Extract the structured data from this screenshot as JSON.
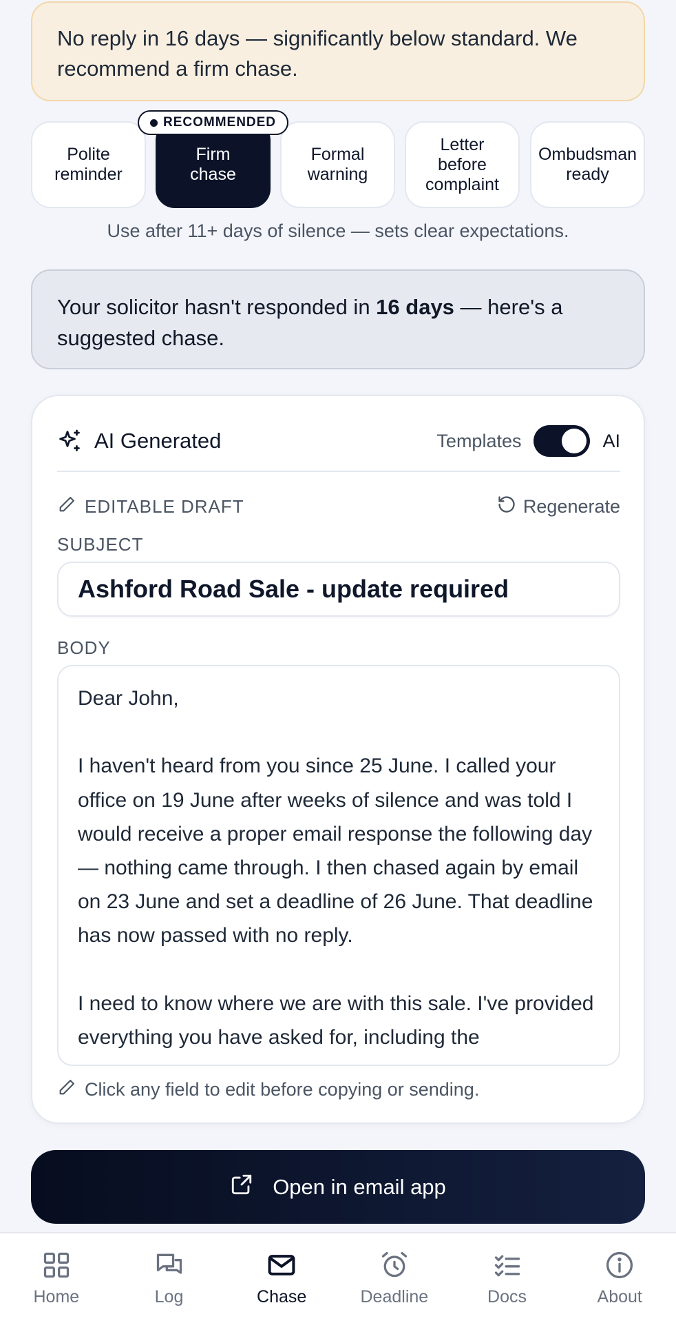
{
  "alert": {
    "text": "No reply in 16 days — significantly below standard. We recommend a firm chase."
  },
  "tones": {
    "badge": "RECOMMENDED",
    "options": [
      {
        "label": "Polite reminder"
      },
      {
        "label": "Firm chase"
      },
      {
        "label": "Formal warning"
      },
      {
        "label": "Letter before complaint"
      },
      {
        "label": "Ombudsman ready"
      }
    ],
    "selected": "Firm chase",
    "hint": "Use after 11+ days of silence — sets clear expectations."
  },
  "info": {
    "prefix": "Your solicitor hasn't responded in ",
    "days": "16 days",
    "suffix": " — here's a suggested chase."
  },
  "card": {
    "title": "AI Generated",
    "toggle_left": "Templates",
    "toggle_right": "AI",
    "toggle_state": "AI",
    "draft_label": "EDITABLE DRAFT",
    "regenerate": "Regenerate",
    "subject_label": "SUBJECT",
    "subject_value": "Ashford Road Sale - update required",
    "body_label": "BODY",
    "body_value": "Dear John,\n\nI haven't heard from you since 25 June. I called your office on 19 June after weeks of silence and was told I would receive a proper email response the following day — nothing came through. I then chased again by email on 23 June and set a deadline of 26 June. That deadline has now passed with no reply.\n\nI need to know where we are with this sale. I've provided everything you have asked for, including the",
    "edit_hint": "Click any field to edit before copying or sending."
  },
  "email_button": {
    "label": "Open in email app"
  },
  "nav": {
    "items": [
      {
        "label": "Home",
        "icon": "grid-icon"
      },
      {
        "label": "Log",
        "icon": "chat-icon"
      },
      {
        "label": "Chase",
        "icon": "mail-icon"
      },
      {
        "label": "Deadline",
        "icon": "alarm-clock-icon"
      },
      {
        "label": "Docs",
        "icon": "checklist-icon"
      },
      {
        "label": "About",
        "icon": "info-icon"
      }
    ],
    "active": "Chase"
  },
  "colors": {
    "primary_dark": "#0c1328",
    "warning_bg": "#f8efe1",
    "info_bg": "#e6e9f0"
  }
}
